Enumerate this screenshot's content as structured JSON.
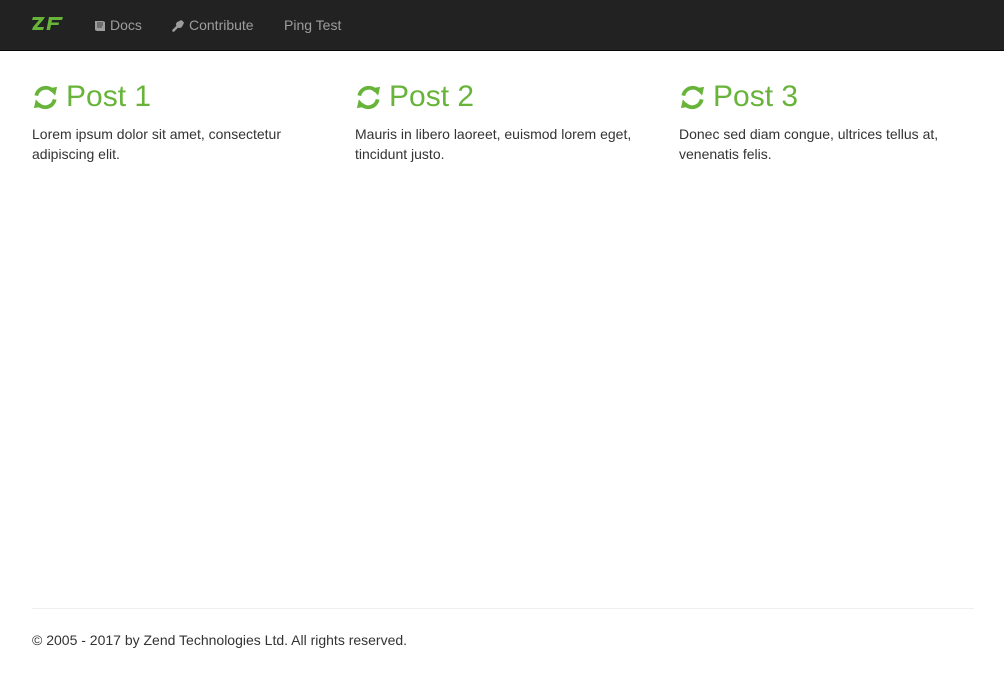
{
  "navbar": {
    "brand_icon": "zf-logo-icon",
    "items": [
      {
        "label": "Docs",
        "icon": "book-icon"
      },
      {
        "label": "Contribute",
        "icon": "wrench-icon"
      },
      {
        "label": "Ping Test"
      }
    ]
  },
  "posts": [
    {
      "title": "Post 1",
      "icon": "refresh-icon",
      "body": "Lorem ipsum dolor sit amet, consectetur adipiscing elit."
    },
    {
      "title": "Post 2",
      "icon": "refresh-icon",
      "body": "Mauris in libero laoreet, euismod lorem eget, tincidunt justo."
    },
    {
      "title": "Post 3",
      "icon": "refresh-icon",
      "body": "Donec sed diam congue, ultrices tellus at, venenatis felis."
    }
  ],
  "footer": {
    "copyright": "© 2005 - 2017 by Zend Technologies Ltd. All rights reserved."
  },
  "colors": {
    "navbar_bg": "#222222",
    "nav_text": "#9d9d9d",
    "accent": "#68b43a"
  }
}
